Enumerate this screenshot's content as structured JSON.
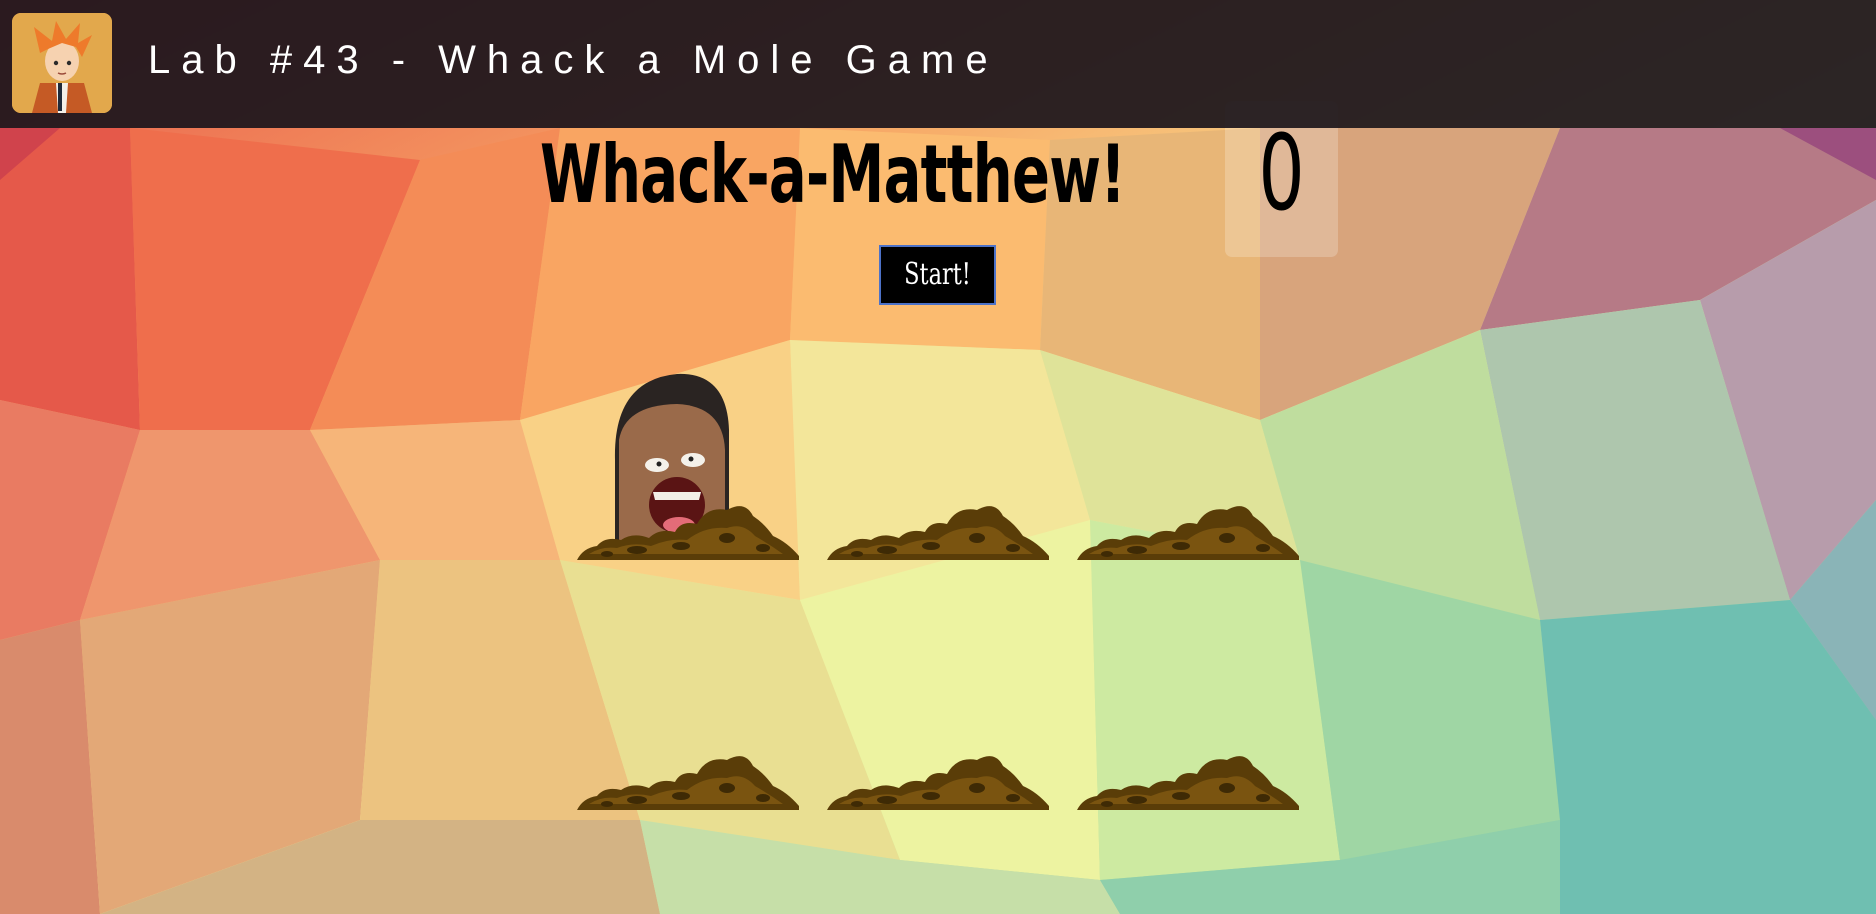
{
  "header": {
    "title": "Lab #43 - Whack a Mole Game",
    "avatar_icon": "anime-avatar-icon"
  },
  "game": {
    "title": "Whack-a-Matthew!",
    "score": "0",
    "start_label": "Start!",
    "holes": [
      {
        "id": 1,
        "mole_up": true
      },
      {
        "id": 2,
        "mole_up": false
      },
      {
        "id": 3,
        "mole_up": false
      },
      {
        "id": 4,
        "mole_up": false
      },
      {
        "id": 5,
        "mole_up": false
      },
      {
        "id": 6,
        "mole_up": false
      }
    ]
  },
  "colors": {
    "header_bg": "#1c161c",
    "start_bg": "#000000",
    "start_border": "#4d72c8",
    "dirt": "#5a3d08"
  }
}
